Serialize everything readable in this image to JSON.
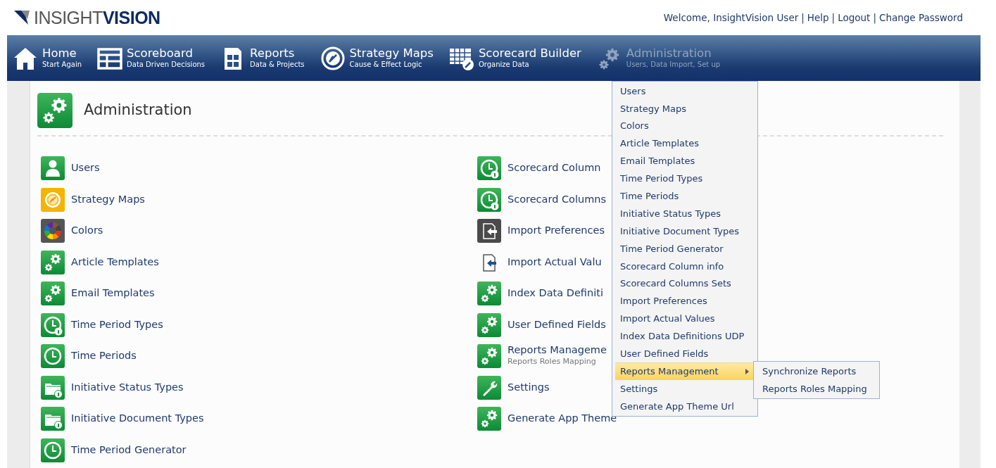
{
  "brand": {
    "light": "INSIGHT",
    "bold": "VISION"
  },
  "user_bar": [
    "Welcome, InsightVision User",
    "|",
    "Help",
    "|",
    "Logout",
    "|",
    "Change Password"
  ],
  "nav": [
    {
      "kind": "home",
      "title": "Home",
      "subtitle": "Start Again",
      "selected": false
    },
    {
      "kind": "grid",
      "title": "Scoreboard",
      "subtitle": "Data Driven Decisions",
      "selected": false
    },
    {
      "kind": "report",
      "title": "Reports",
      "subtitle": "Data & Projects",
      "selected": false
    },
    {
      "kind": "compass",
      "title": "Strategy Maps",
      "subtitle": "Cause & Effect Logic",
      "selected": false
    },
    {
      "kind": "builder",
      "title": "Scorecard Builder",
      "subtitle": "Organize Data",
      "selected": false
    },
    {
      "kind": "gears",
      "title": "Administration",
      "subtitle": "Users, Data Import, Set up",
      "selected": true
    }
  ],
  "page_title": "Administration",
  "left_items": [
    {
      "kind": "person",
      "label": "Users"
    },
    {
      "kind": "target",
      "label": "Strategy Maps"
    },
    {
      "kind": "palette",
      "label": "Colors"
    },
    {
      "kind": "gears",
      "label": "Article Templates"
    },
    {
      "kind": "gears",
      "label": "Email Templates"
    },
    {
      "kind": "clockinfo",
      "label": "Time Period Types"
    },
    {
      "kind": "clock",
      "label": "Time Periods"
    },
    {
      "kind": "folderq",
      "label": "Initiative Status Types"
    },
    {
      "kind": "folderi",
      "label": "Initiative Document Types"
    },
    {
      "kind": "clock",
      "label": "Time Period Generator"
    }
  ],
  "right_items": [
    {
      "kind": "clockinfo",
      "label": "Scorecard Column"
    },
    {
      "kind": "clockinfo",
      "label": "Scorecard Columns"
    },
    {
      "kind": "importdark",
      "label": "Import Preferences"
    },
    {
      "kind": "importdoc",
      "label": "Import Actual Valu"
    },
    {
      "kind": "gears",
      "label": "Index Data Definiti"
    },
    {
      "kind": "gears",
      "label": "User Defined Fields"
    },
    {
      "kind": "gears",
      "label": "Reports Manageme",
      "sublabel": "Reports Roles Mapping"
    },
    {
      "kind": "wrench",
      "label": "Settings"
    },
    {
      "kind": "gears",
      "label": "Generate App Theme"
    }
  ],
  "dropdown": [
    {
      "label": "Users",
      "selected": false
    },
    {
      "label": "Strategy Maps",
      "selected": false
    },
    {
      "label": "Colors",
      "selected": false
    },
    {
      "label": "Article Templates",
      "selected": false
    },
    {
      "label": "Email Templates",
      "selected": false
    },
    {
      "label": "Time Period Types",
      "selected": false
    },
    {
      "label": "Time Periods",
      "selected": false
    },
    {
      "label": "Initiative Status Types",
      "selected": false
    },
    {
      "label": "Initiative Document Types",
      "selected": false
    },
    {
      "label": "Time Period Generator",
      "selected": false
    },
    {
      "label": "Scorecard Column info",
      "selected": false
    },
    {
      "label": "Scorecard Columns Sets",
      "selected": false
    },
    {
      "label": "Import Preferences",
      "selected": false
    },
    {
      "label": "Import Actual Values",
      "selected": false
    },
    {
      "label": "Index Data Definitions UDP",
      "selected": false
    },
    {
      "label": "User Defined Fields",
      "selected": false
    },
    {
      "label": "Reports Management",
      "selected": true,
      "submenu": [
        {
          "label": "Synchronize Reports"
        },
        {
          "label": "Reports Roles Mapping"
        }
      ]
    },
    {
      "label": "Settings",
      "selected": false
    },
    {
      "label": "Generate App Theme Url",
      "selected": false
    }
  ]
}
